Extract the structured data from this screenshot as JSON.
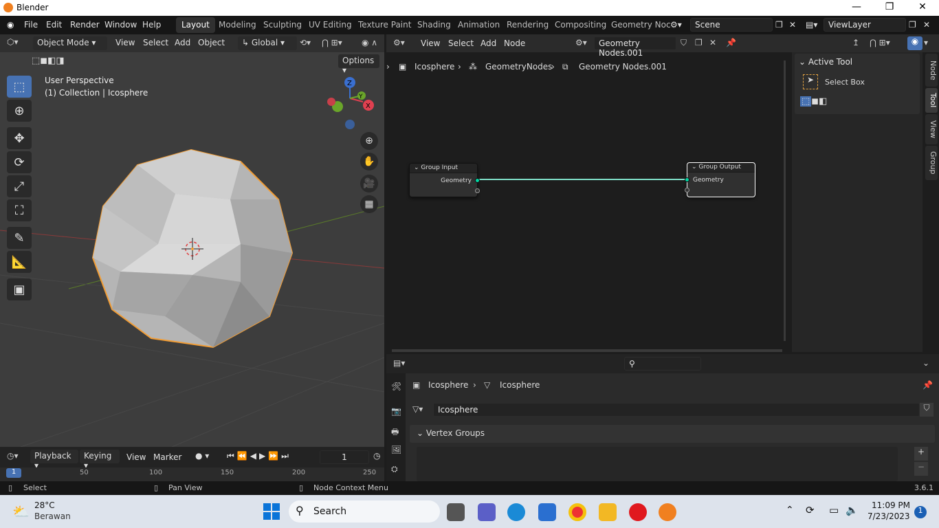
{
  "window": {
    "title": "Blender"
  },
  "menu": [
    "File",
    "Edit",
    "Render",
    "Window",
    "Help"
  ],
  "workspaces": [
    "Layout",
    "Modeling",
    "Sculpting",
    "UV Editing",
    "Texture Paint",
    "Shading",
    "Animation",
    "Rendering",
    "Compositing",
    "Geometry Noc"
  ],
  "scene": {
    "name": "Scene",
    "view_layer": "ViewLayer"
  },
  "viewport": {
    "mode": "Object Mode",
    "menus": [
      "View",
      "Select",
      "Add",
      "Object"
    ],
    "orientation": "Global",
    "options": "Options",
    "overlay_title": "User Perspective",
    "overlay_sub": "(1) Collection | Icosphere",
    "axes": {
      "x": "X",
      "y": "Y",
      "z": "Z"
    }
  },
  "node_editor": {
    "menus": [
      "View",
      "Select",
      "Add",
      "Node"
    ],
    "tree_name": "Geometry Nodes.001",
    "breadcrumb": [
      "Icosphere",
      "GeometryNodes",
      "Geometry Nodes.001"
    ],
    "nodes": {
      "input_title": "Group Input",
      "input_socket": "Geometry",
      "output_title": "Group Output",
      "output_socket": "Geometry"
    }
  },
  "sidebar": {
    "active_tool_title": "Active Tool",
    "tool_name": "Select Box",
    "tabs": [
      "Node",
      "Tool",
      "View",
      "Group"
    ]
  },
  "properties": {
    "breadcrumb": [
      "Icosphere",
      "Icosphere"
    ],
    "mesh_name": "Icosphere",
    "panel": "Vertex Groups"
  },
  "timeline": {
    "menus": [
      "Playback",
      "Keying",
      "View",
      "Marker"
    ],
    "frame": "1",
    "ticks": [
      "1",
      "50",
      "100",
      "150",
      "200",
      "250"
    ]
  },
  "status": {
    "left": "Select",
    "mid": "Pan View",
    "right": "Node Context Menu",
    "version": "3.6.1"
  },
  "taskbar": {
    "temp": "28°C",
    "weather": "Berawan",
    "search": "Search",
    "time": "11:09 PM",
    "date": "7/23/2023",
    "badge": "1"
  }
}
